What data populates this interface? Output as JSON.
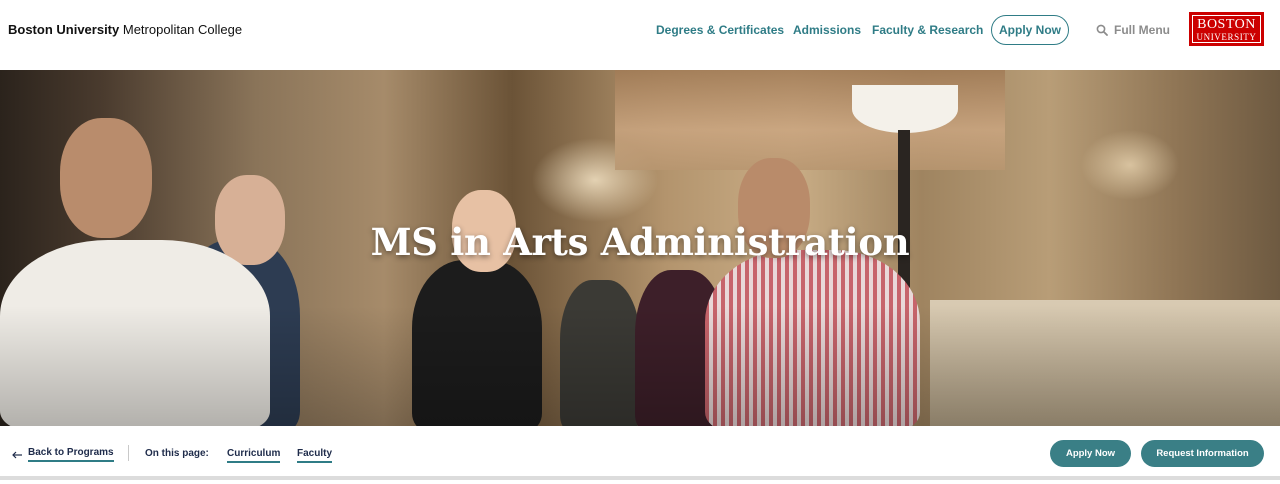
{
  "header": {
    "brand_bold": "Boston University",
    "brand_rest": " Metropolitan College",
    "nav": [
      "Degrees & Certificates",
      "Admissions",
      "Faculty & Research"
    ],
    "apply_label": "Apply Now",
    "full_menu_label": "Full Menu",
    "full_menu_icon": "search-icon",
    "logo_line1": "BOSTON",
    "logo_line2": "UNIVERSITY"
  },
  "hero": {
    "title": "MS in Arts Administration"
  },
  "subnav": {
    "back_label": "Back to Programs",
    "back_icon": "arrow-left-icon",
    "on_page_label": "On this page:",
    "links": [
      "Curriculum",
      "Faculty"
    ],
    "apply_label": "Apply Now",
    "request_label": "Request Information"
  },
  "colors": {
    "accent": "#2f7c86",
    "button_fill": "#3a7f86",
    "brand_red": "#cc0000",
    "nav_text": "#1e2b4a"
  }
}
